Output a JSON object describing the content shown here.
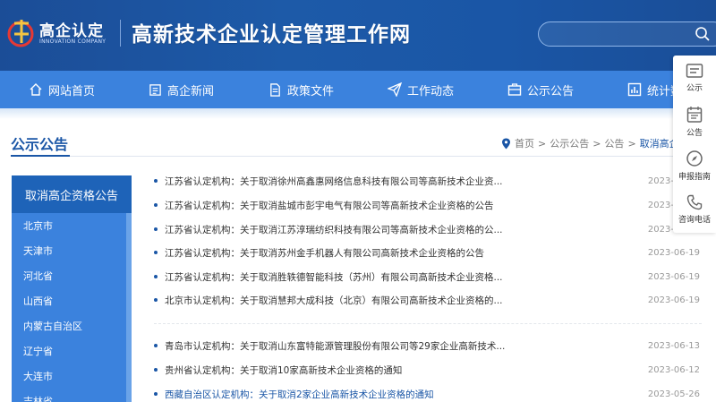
{
  "header": {
    "logo_cn": "高企认定",
    "logo_en": "INNOVATION COMPANY",
    "site_title": "高新技术企业认定管理工作网"
  },
  "nav": {
    "items": [
      {
        "label": "网站首页",
        "icon": "home-icon"
      },
      {
        "label": "高企新闻",
        "icon": "news-icon"
      },
      {
        "label": "政策文件",
        "icon": "document-icon"
      },
      {
        "label": "工作动态",
        "icon": "send-icon"
      },
      {
        "label": "公示公告",
        "icon": "briefcase-icon"
      },
      {
        "label": "统计数",
        "icon": "chart-icon"
      }
    ]
  },
  "section": {
    "title": "公示公告",
    "breadcrumb": [
      "首页",
      "公示公告",
      "公告",
      "取消高企资格公"
    ]
  },
  "sidebar": {
    "heading": "取消高企资格公告",
    "items": [
      "北京市",
      "天津市",
      "河北省",
      "山西省",
      "内蒙古自治区",
      "辽宁省",
      "大连市",
      "吉林省"
    ]
  },
  "list": {
    "group1": [
      {
        "text": "江苏省认定机构：关于取消徐州高鑫惠网络信息科技有限公司等高新技术企业资...",
        "date": "2023-06-19"
      },
      {
        "text": "江苏省认定机构：关于取消盐城市彭宇电气有限公司等高新技术企业资格的公告",
        "date": "2023-06-19"
      },
      {
        "text": "江苏省认定机构：关于取消江苏淳瑞纺织科技有限公司等高新技术企业资格的公...",
        "date": "2023-06-19"
      },
      {
        "text": "江苏省认定机构：关于取消苏州金手机器人有限公司高新技术企业资格的公告",
        "date": "2023-06-19"
      },
      {
        "text": "江苏省认定机构：关于取消胜轶德智能科技（苏州）有限公司高新技术企业资格...",
        "date": "2023-06-19"
      },
      {
        "text": "北京市认定机构：关于取消慧邦大成科技（北京）有限公司高新技术企业资格的...",
        "date": "2023-06-19"
      }
    ],
    "group2": [
      {
        "text": "青岛市认定机构：关于取消山东富特能源管理股份有限公司等29家企业高新技术...",
        "date": "2023-06-13"
      },
      {
        "text": "贵州省认定机构：关于取消10家高新技术企业资格的通知",
        "date": "2023-06-12"
      },
      {
        "text": "西藏自治区认定机构：关于取消2家企业高新技术企业资格的通知",
        "date": "2023-05-26"
      }
    ]
  },
  "float_toolbar": [
    {
      "label": "公示",
      "icon": "notice-icon"
    },
    {
      "label": "公告",
      "icon": "calendar-icon"
    },
    {
      "label": "申报指南",
      "icon": "compass-icon"
    },
    {
      "label": "咨询电话",
      "icon": "phone-icon"
    }
  ]
}
